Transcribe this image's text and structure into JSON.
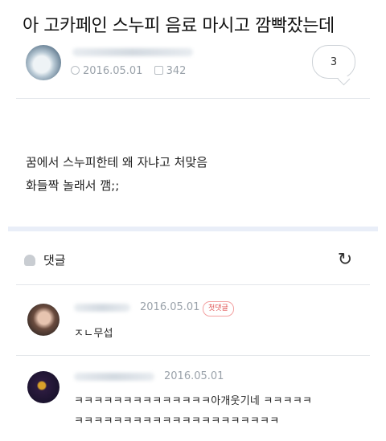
{
  "post": {
    "title": "아 고카페인 스누피 음료 마시고 깜빡잤는데",
    "date": "2016.05.01",
    "views": "342",
    "comment_count": "3",
    "body_lines": [
      "꿈에서 스누피한테 왜 자냐고 처맞음",
      "화들짝 놀래서 깸;;"
    ]
  },
  "comments_section": {
    "label": "댓글"
  },
  "comments": [
    {
      "date": "2016.05.01",
      "badge": "첫댓글",
      "text": "ㅈㄴ무섭"
    },
    {
      "date": "2016.05.01",
      "text_line1": "ㅋㅋㅋㅋㅋㅋㅋㅋㅋㅋㅋㅋㅋㅋ아개웃기네 ㅋㅋㅋㅋㅋ",
      "text_line2": "ㅋㅋㅋㅋㅋㅋㅋㅋㅋㅋㅋㅋㅋㅋㅋㅋㅋㅋㅋㅋㅋ"
    }
  ]
}
